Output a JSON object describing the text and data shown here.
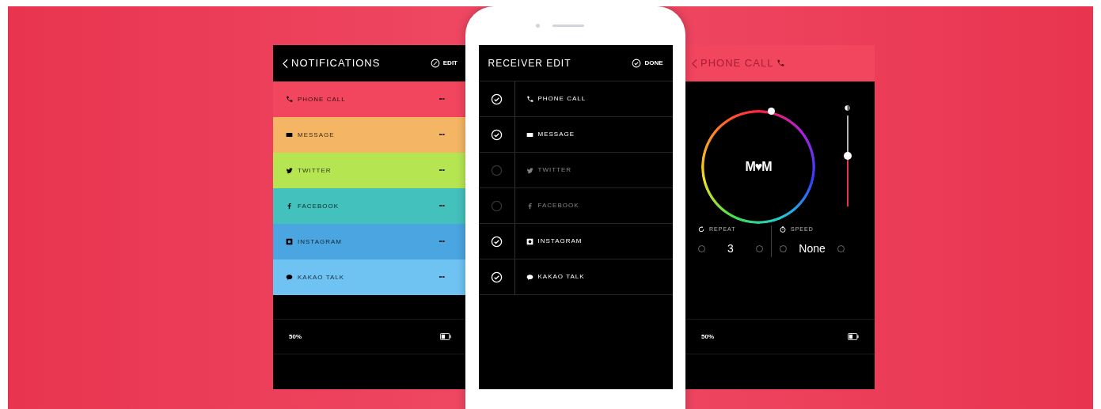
{
  "notifications_screen": {
    "title": "NOTIFICATIONS",
    "edit_button": "EDIT",
    "items": [
      {
        "kind": "phone",
        "label": "PHONE CALL",
        "color": "#f2455e",
        "more": "•••"
      },
      {
        "kind": "message",
        "label": "MESSAGE",
        "color": "#f4b664",
        "more": "•••"
      },
      {
        "kind": "twitter",
        "label": "TWITTER",
        "color": "#b5e652",
        "more": "•••"
      },
      {
        "kind": "facebook",
        "label": "FACEBOOK",
        "color": "#43c1bd",
        "more": "•••"
      },
      {
        "kind": "instagram",
        "label": "INSTAGRAM",
        "color": "#4aa5e0",
        "more": "•••"
      },
      {
        "kind": "kakao",
        "label": "KAKAO TALK",
        "color": "#6fc3f3",
        "more": "•••"
      }
    ],
    "battery": "50%"
  },
  "receiver_edit_screen": {
    "title": "RECEIVER EDIT",
    "done_button": "DONE",
    "items": [
      {
        "kind": "phone",
        "label": "PHONE CALL",
        "checked": true
      },
      {
        "kind": "message",
        "label": "MESSAGE",
        "checked": true
      },
      {
        "kind": "twitter",
        "label": "TWITTER",
        "checked": false
      },
      {
        "kind": "facebook",
        "label": "FACEBOOK",
        "checked": false
      },
      {
        "kind": "instagram",
        "label": "INSTAGRAM",
        "checked": true
      },
      {
        "kind": "kakao",
        "label": "KAKAO TALK",
        "checked": true
      }
    ]
  },
  "phone_call_screen": {
    "title": "PHONE CALL",
    "logo": "M♥M",
    "brightness": {
      "level": 0.56
    },
    "repeat": {
      "label": "REPEAT",
      "value": "3"
    },
    "speed": {
      "label": "SPEED",
      "value": "None"
    },
    "battery": "50%"
  }
}
